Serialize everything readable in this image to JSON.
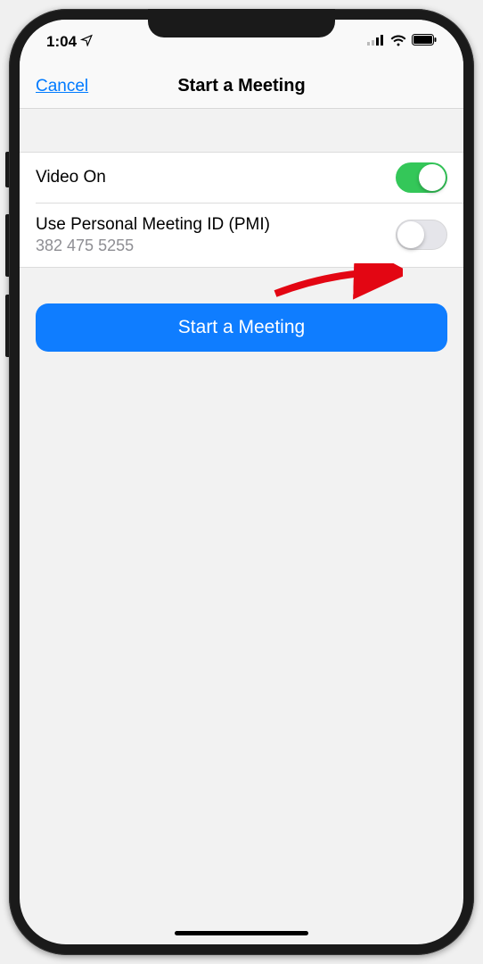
{
  "status": {
    "time": "1:04"
  },
  "nav": {
    "cancel": "Cancel",
    "title": "Start a Meeting"
  },
  "settings": {
    "video_label": "Video On",
    "pmi_label": "Use Personal Meeting ID (PMI)",
    "pmi_value": "382 475 5255"
  },
  "action": {
    "start_label": "Start a Meeting"
  }
}
